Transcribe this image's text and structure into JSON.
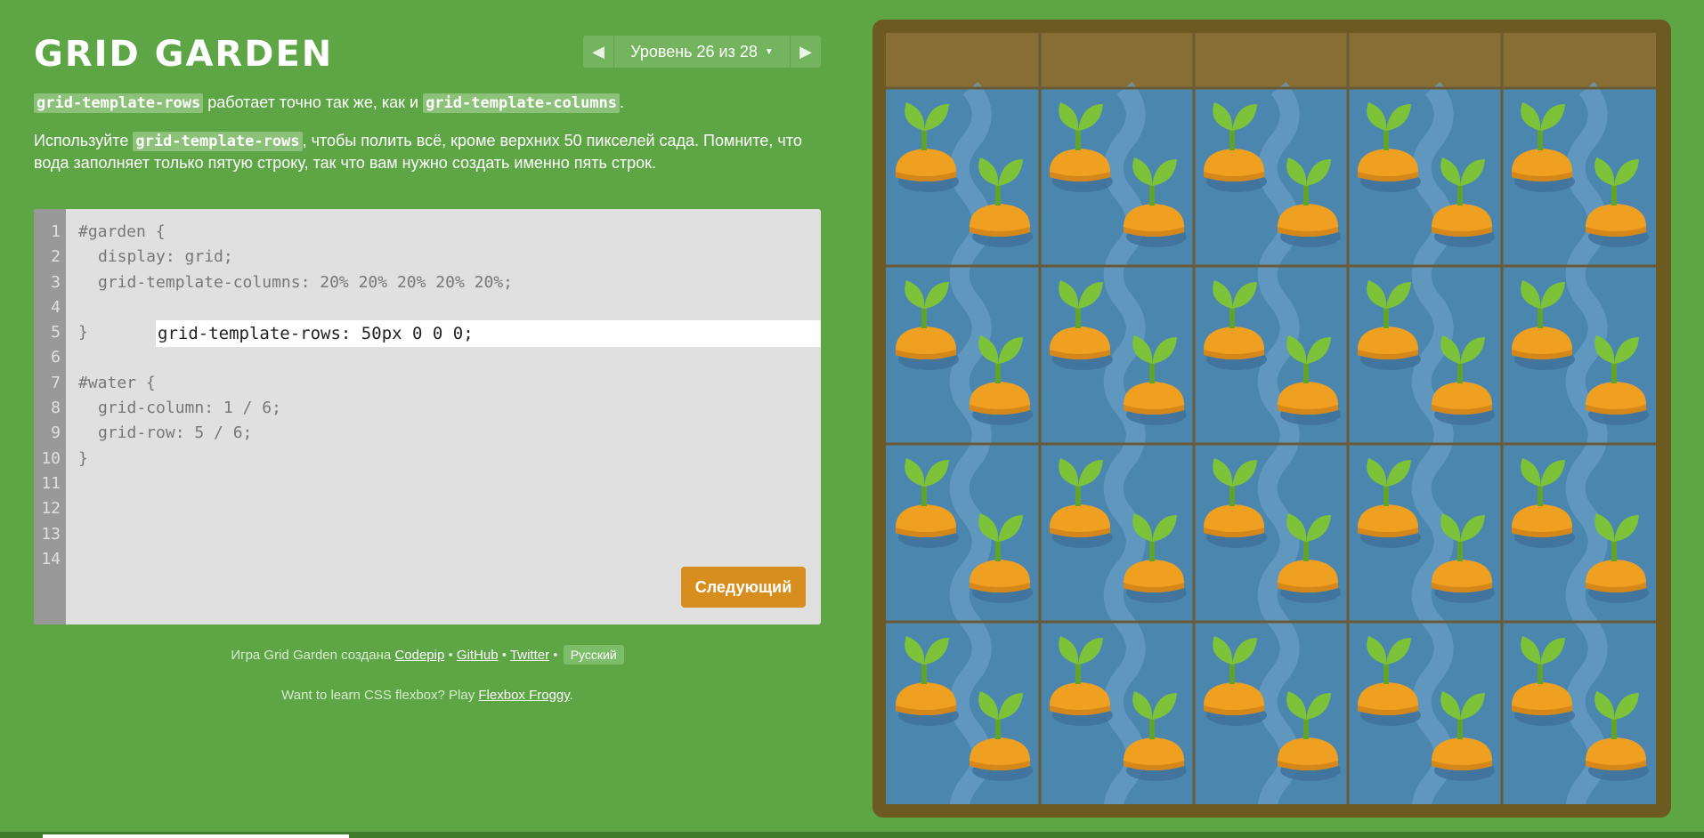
{
  "title": "GRID GARDEN",
  "level": {
    "label": "Уровень 26 из 28",
    "current": 26,
    "total": 28,
    "prev_icon": "arrow-left-icon",
    "next_icon": "arrow-right-icon",
    "dropdown_icon": "caret-down-icon"
  },
  "instructions": {
    "p1_kw1": "grid-template-rows",
    "p1_mid": " работает точно так же, как и ",
    "p1_kw2": "grid-template-columns",
    "p1_end": ".",
    "p2_start": "Используйте ",
    "p2_kw": "grid-template-rows",
    "p2_end": ", чтобы полить всё, кроме верхних 50 пикселей сада. Помните, что вода заполняет только пятую строку, так что вам нужно создать именно пять строк."
  },
  "editor": {
    "line_numbers": [
      "1",
      "2",
      "3",
      "4",
      "5",
      "6",
      "7",
      "8",
      "9",
      "10",
      "11",
      "12",
      "13",
      "14"
    ],
    "lines": {
      "l1": "#garden {",
      "l2": "display: grid;",
      "l3": "grid-template-columns: 20% 20% 20% 20% 20%;",
      "l5": "}",
      "l7": "#water {",
      "l8": "grid-column: 1 / 6;",
      "l9": "grid-row: 5 / 6;",
      "l10": "}"
    },
    "input_value": "grid-template-rows: 50px 0 0 0;"
  },
  "next_button": "Следующий",
  "credits": {
    "prefix": "Игра Grid Garden создана ",
    "codepip": "Codepip",
    "sep1": " • ",
    "github": "GitHub",
    "sep2": " • ",
    "twitter": "Twitter",
    "sep3": " • ",
    "language": "Русский"
  },
  "promo": {
    "prefix": "Want to learn CSS flexbox? Play ",
    "link": "Flexbox Froggy",
    "suffix": "."
  },
  "colors": {
    "background": "#5ea546",
    "water": "#4b86af",
    "dirt": "#876e34",
    "frame": "#6c5a20",
    "carrot": "#f0a020",
    "leaf": "#7cc33a",
    "button": "#d78e1f"
  }
}
